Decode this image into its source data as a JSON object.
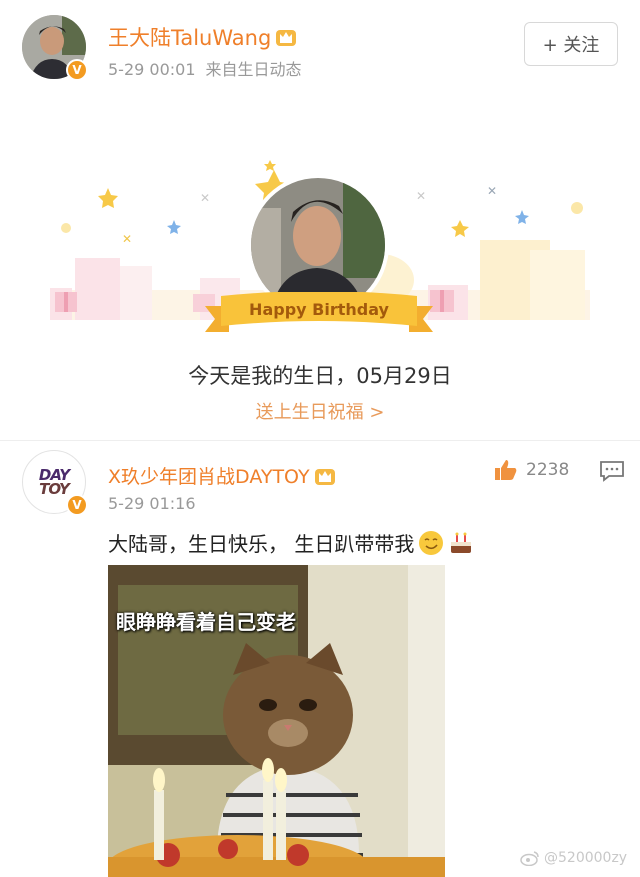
{
  "post": {
    "author": "王大陆TaluWang",
    "timestamp": "5-29 00:01",
    "source": "来自生日动态",
    "follow_label": "+ 关注"
  },
  "birthday_card": {
    "ribbon_text": "Happy Birthday",
    "message": "今天是我的生日，05月29日",
    "link_label": "送上生日祝福 >"
  },
  "comment": {
    "author": "X玖少年团肖战DAYTOY",
    "avatar_logo_line1": "DAY",
    "avatar_logo_line2": "TOY",
    "timestamp": "5-29 01:16",
    "text": "大陆哥，生日快乐， 生日趴带带我",
    "likes": "2238",
    "image_caption": "眼睁睁看着自己变老"
  },
  "watermark": "@520000zy",
  "colors": {
    "accent_orange": "#ef7f2a",
    "verified_badge": "#f39b21",
    "link_orange": "#e89a5a"
  }
}
